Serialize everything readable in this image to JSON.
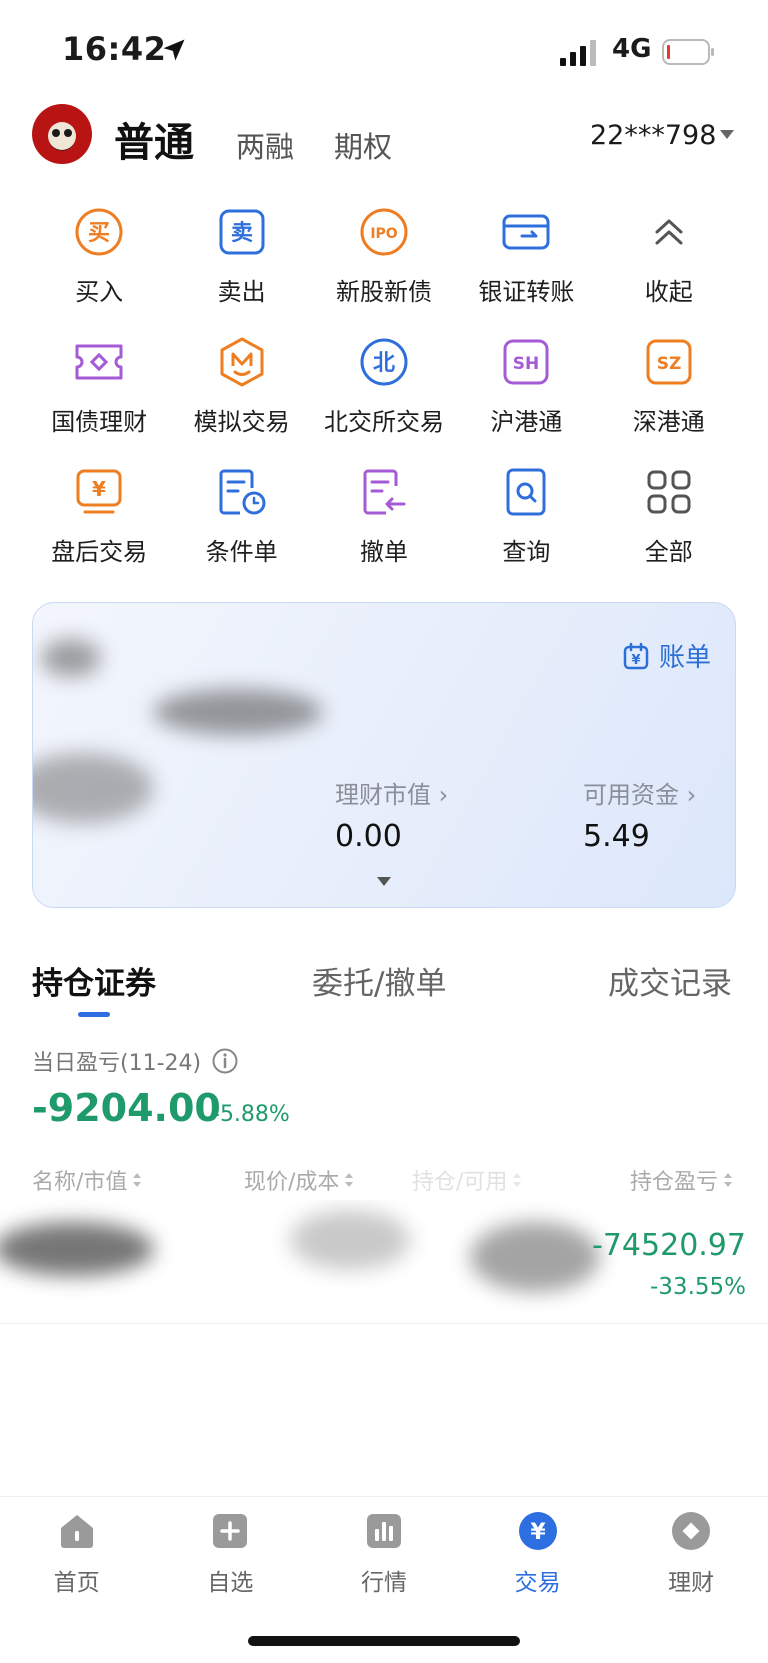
{
  "status_bar": {
    "time": "16:42",
    "network": "4G"
  },
  "header": {
    "tabs": [
      {
        "label": "普通",
        "active": true
      },
      {
        "label": "两融",
        "active": false
      },
      {
        "label": "期权",
        "active": false
      }
    ],
    "account": "22***798"
  },
  "quick_actions": [
    {
      "label": "买入",
      "icon": "buy-icon",
      "color": "#ef7d22"
    },
    {
      "label": "卖出",
      "icon": "sell-icon",
      "color": "#2f6fdc"
    },
    {
      "label": "新股新债",
      "icon": "ipo-icon",
      "color": "#ef7d22"
    },
    {
      "label": "银证转账",
      "icon": "transfer-icon",
      "color": "#2f6fdc"
    },
    {
      "label": "收起",
      "icon": "collapse-icon",
      "color": "#666666"
    },
    {
      "label": "国债理财",
      "icon": "bond-icon",
      "color": "#a55ad6"
    },
    {
      "label": "模拟交易",
      "icon": "simulate-icon",
      "color": "#ef7d22"
    },
    {
      "label": "北交所交易",
      "icon": "bse-icon",
      "color": "#2f6fdc"
    },
    {
      "label": "沪港通",
      "icon": "sh-hk-icon",
      "color": "#a55ad6"
    },
    {
      "label": "深港通",
      "icon": "sz-hk-icon",
      "color": "#ef7d22"
    },
    {
      "label": "盘后交易",
      "icon": "after-hours-icon",
      "color": "#ef7d22"
    },
    {
      "label": "条件单",
      "icon": "conditional-order-icon",
      "color": "#2f6fdc"
    },
    {
      "label": "撤单",
      "icon": "cancel-order-icon",
      "color": "#a55ad6"
    },
    {
      "label": "查询",
      "icon": "query-icon",
      "color": "#2f6fdc"
    },
    {
      "label": "全部",
      "icon": "all-grid-icon",
      "color": "#555555"
    }
  ],
  "icon_glyphs": {
    "buy": "买",
    "sell": "卖",
    "ipo": "IPO",
    "bse": "北",
    "sh": "SH",
    "sz": "SZ",
    "yen": "¥"
  },
  "account_card": {
    "bill_label": "账单",
    "metrics": [
      {
        "label": "理财市值 ›",
        "value": "0.00"
      },
      {
        "label": "可用资金 ›",
        "value": "5.49"
      }
    ]
  },
  "position_tabs": [
    "持仓证券",
    "委托/撤单",
    "成交记录"
  ],
  "daily_pnl": {
    "label": "当日盈亏(11-24)",
    "value": "-9204.00",
    "percent": "-5.88%"
  },
  "columns": [
    "名称/市值",
    "现价/成本",
    "持仓/可用",
    "持仓盈亏"
  ],
  "holdings": [
    {
      "pnl": "-74520.97",
      "pnl_pct": "-33.55%"
    }
  ],
  "bottom_nav": [
    {
      "label": "首页",
      "icon": "home-icon",
      "active": false
    },
    {
      "label": "自选",
      "icon": "watchlist-icon",
      "active": false
    },
    {
      "label": "行情",
      "icon": "market-icon",
      "active": false
    },
    {
      "label": "交易",
      "icon": "trade-icon",
      "active": true
    },
    {
      "label": "理财",
      "icon": "wealth-icon",
      "active": false
    }
  ],
  "colors": {
    "accent": "#2d6fe0",
    "loss": "#1f9a6a",
    "orange": "#ef7d22",
    "purple": "#a55ad6"
  }
}
